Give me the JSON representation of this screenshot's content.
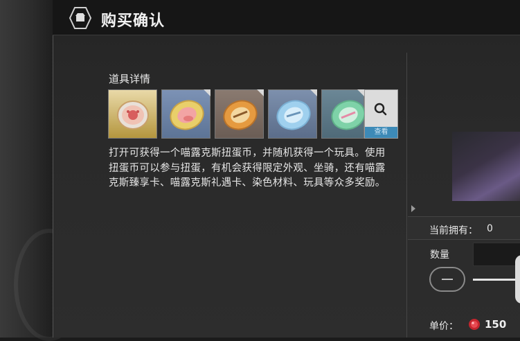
{
  "header": {
    "title": "购买确认",
    "icon": "merchant-icon"
  },
  "item_details": {
    "label": "道具详情",
    "items": [
      {
        "name": "coin-pink",
        "bg": "#b4963e",
        "accent": "#e47a7a"
      },
      {
        "name": "coin-yellow",
        "bg": "#5d7496",
        "accent": "#e9cf6a"
      },
      {
        "name": "coin-orange",
        "bg": "#6b5d55",
        "accent": "#e59a40"
      },
      {
        "name": "coin-blue",
        "bg": "#5b6d8a",
        "accent": "#9fd0ee"
      },
      {
        "name": "coin-green",
        "bg": "#4f6a78",
        "accent": "#7ed2a8"
      }
    ],
    "view_button_label": "查看",
    "description": "打开可获得一个喵露克斯扭蛋币，并随机获得一个玩具。使用扭蛋币可以参与扭蛋，有机会获得限定外观、坐骑，还有喵露克斯臻享卡、喵露克斯礼遇卡、染色材料、玩具等众多奖励。"
  },
  "purchase": {
    "owned_label": "当前拥有：",
    "owned_value": "0",
    "quantity_label": "数量",
    "minus_icon": "minus-icon",
    "price_label": "单价：",
    "price_value": "150",
    "currency_icon": "red-gem-icon"
  },
  "colors": {
    "accent_blue": "#3d8ab7"
  }
}
